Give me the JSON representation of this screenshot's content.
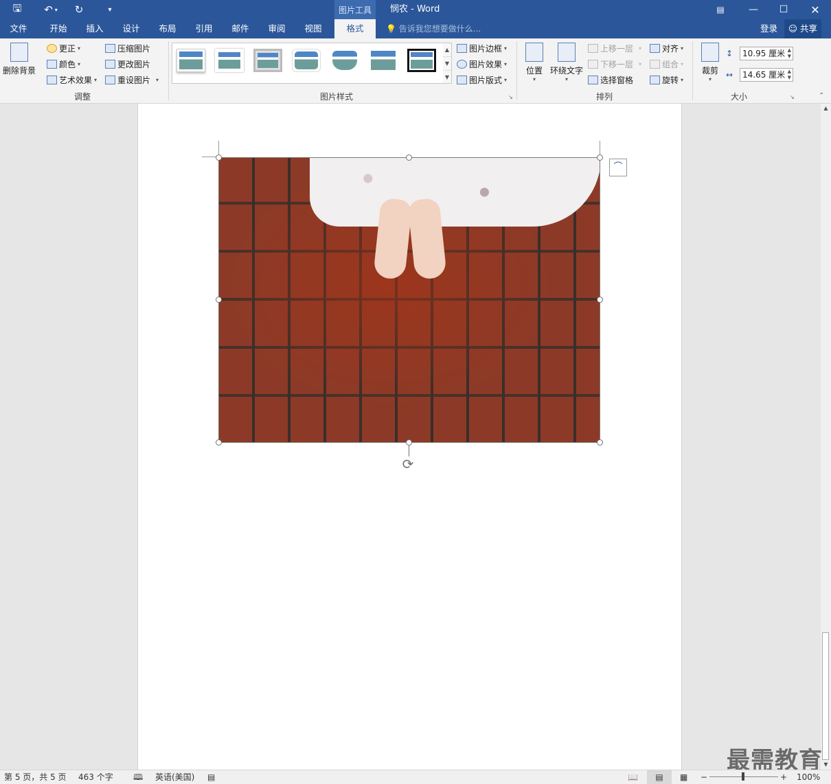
{
  "titlebar": {
    "context_tools": "图片工具",
    "doc_title": "悯农 - Word"
  },
  "tabs": [
    "文件",
    "开始",
    "插入",
    "设计",
    "布局",
    "引用",
    "邮件",
    "审阅",
    "视图",
    "格式"
  ],
  "active_tab": "格式",
  "tell_me": "告诉我您想要做什么...",
  "account": {
    "login": "登录",
    "share": "共享"
  },
  "ribbon": {
    "adjust": {
      "label": "调整",
      "remove_bg": "删除背景",
      "corrections": "更正",
      "color": "颜色",
      "artistic": "艺术效果",
      "compress": "压缩图片",
      "change": "更改图片",
      "reset": "重设图片"
    },
    "styles": {
      "label": "图片样式",
      "border": "图片边框",
      "effects": "图片效果",
      "layout": "图片版式"
    },
    "arrange": {
      "label": "排列",
      "position": "位置",
      "wrap": "环绕文字",
      "bring_forward": "上移一层",
      "send_backward": "下移一层",
      "selection_pane": "选择窗格",
      "align": "对齐",
      "group": "组合",
      "rotate": "旋转"
    },
    "size": {
      "label": "大小",
      "crop": "裁剪",
      "height": "10.95 厘米",
      "width": "14.65 厘米"
    }
  },
  "status": {
    "page": "第 5 页，共 5 页",
    "words": "463 个字",
    "language": "英语(美国)",
    "zoom": "100%"
  },
  "watermark": "最需教育",
  "colors": {
    "accent": "#2b579a",
    "ribbon_bg": "#f3f3f3"
  }
}
